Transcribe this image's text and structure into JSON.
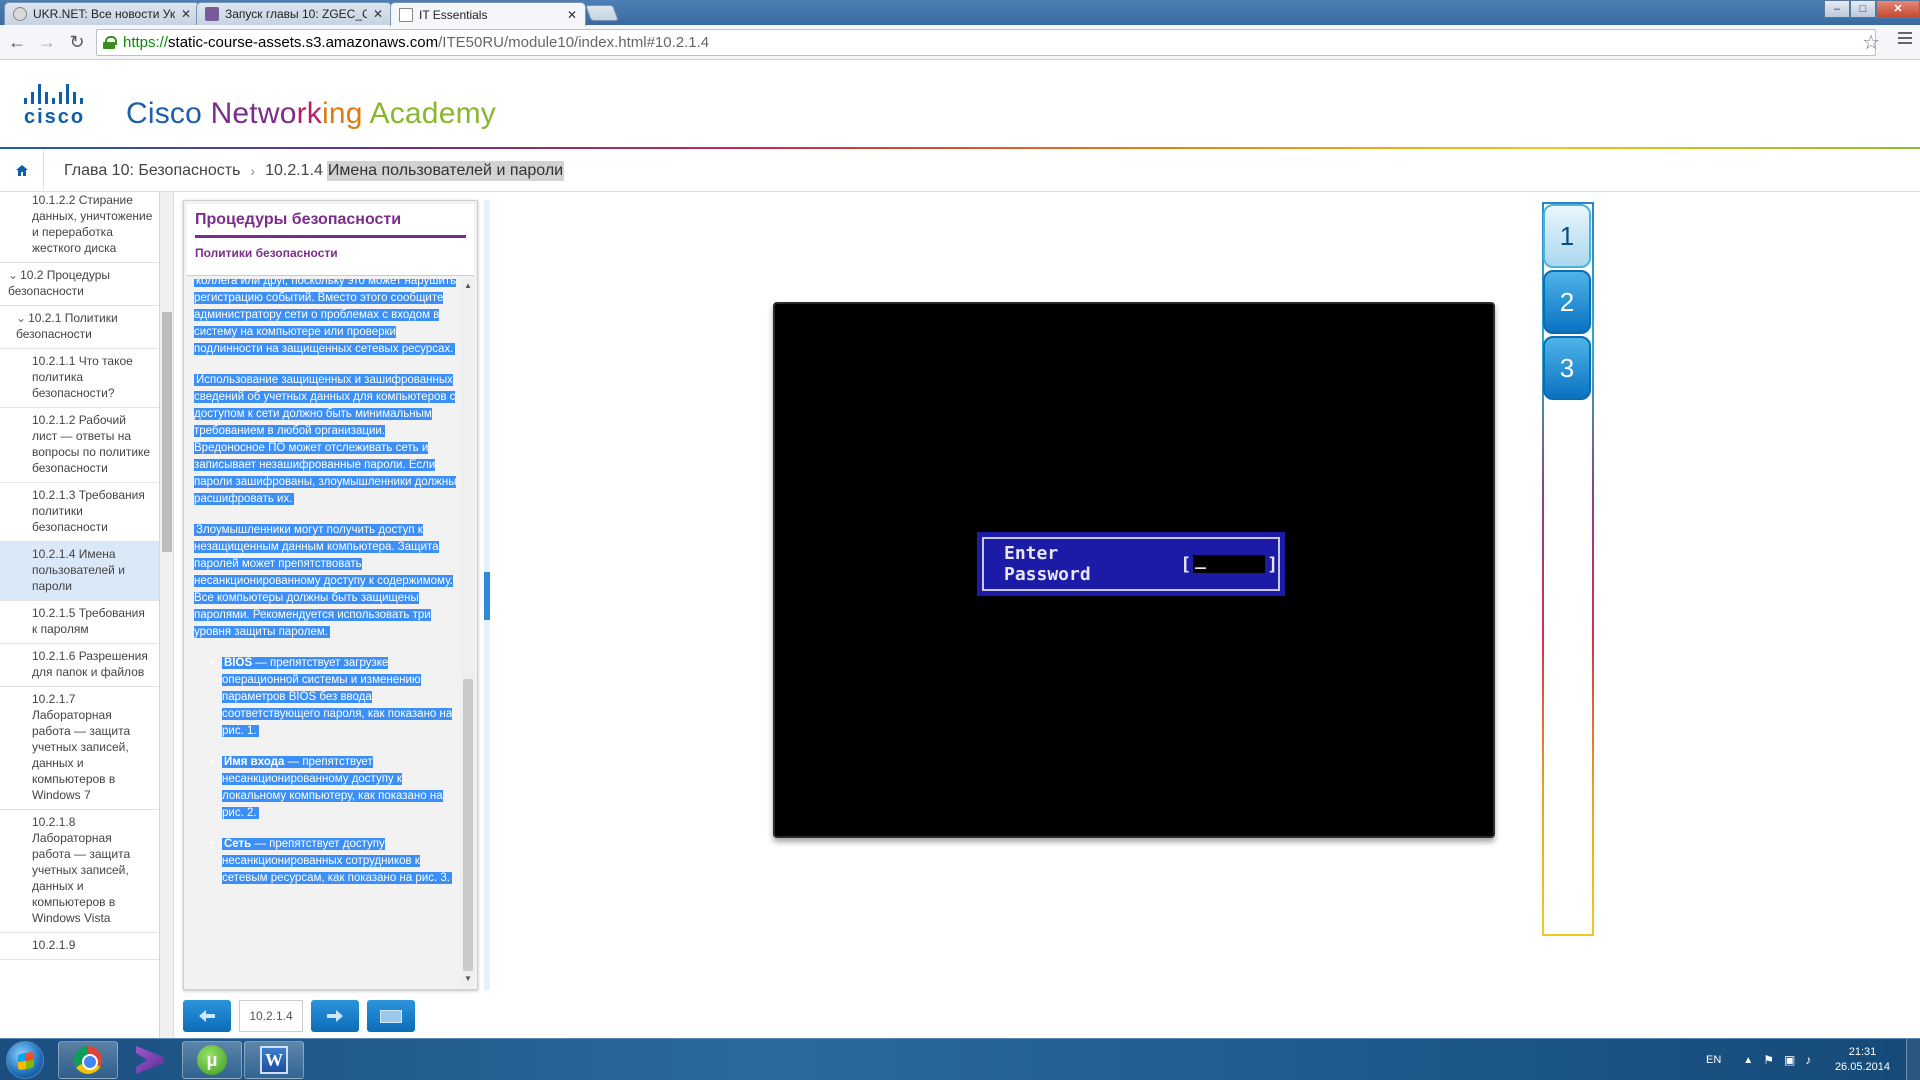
{
  "browser": {
    "tabs": [
      {
        "title": "UKR.NET: Все новости Ук",
        "favicon_color": "#d9d9d9"
      },
      {
        "title": "Запуск главы 10: ZGEC_G",
        "favicon_color": "#7a5a9a"
      },
      {
        "title": "IT Essentials",
        "favicon_color": "#ffffff"
      }
    ],
    "url": {
      "protocol": "https://",
      "host": "static-course-assets.s3.amazonaws.com",
      "path": "/ITE50RU/module10/index.html#10.2.1.4"
    },
    "window_controls": {
      "minimize": "–",
      "maximize": "□",
      "close": "✕"
    }
  },
  "header": {
    "logo_text": "cisco",
    "title_parts": [
      "Cisco ",
      "Netwo",
      "rk",
      "ing ",
      "Academy"
    ]
  },
  "breadcrumb": {
    "home_icon": "home-icon",
    "chapter": "Глава 10: Безопасность",
    "separator": "›",
    "section_num": "10.2.1.4",
    "section_title": "Имена пользователей и пароли"
  },
  "toc": {
    "items": [
      {
        "label": "10.1.2.2 Стирание данных, уничтожение и переработка жесткого диска",
        "level": 3,
        "active": false
      },
      {
        "label": "10.2 Процедуры безопасности",
        "level": 1,
        "caret": "⌄",
        "active": false
      },
      {
        "label": "10.2.1 Политики безопасности",
        "level": 2,
        "caret": "⌄",
        "active": false
      },
      {
        "label": "10.2.1.1 Что такое политика безопасности?",
        "level": 3,
        "active": false
      },
      {
        "label": "10.2.1.2 Рабочий лист — ответы на вопросы по политике безопасности",
        "level": 3,
        "active": false
      },
      {
        "label": "10.2.1.3 Требования политики безопасности",
        "level": 3,
        "active": false
      },
      {
        "label": "10.2.1.4 Имена пользователей и пароли",
        "level": 3,
        "active": true
      },
      {
        "label": "10.2.1.5 Требования к паролям",
        "level": 3,
        "active": false
      },
      {
        "label": "10.2.1.6 Разрешения для папок и файлов",
        "level": 3,
        "active": false
      },
      {
        "label": "10.2.1.7 Лабораторная работа — защита учетных записей, данных и компьютеров в Windows 7",
        "level": 3,
        "active": false
      },
      {
        "label": "10.2.1.8 Лабораторная работа — защита учетных записей, данных и компьютеров в Windows Vista",
        "level": 3,
        "active": false
      },
      {
        "label": "10.2.1.9",
        "level": 3,
        "active": false
      }
    ]
  },
  "panel": {
    "title": "Процедуры безопасности",
    "subtitle": "Политики безопасности",
    "paragraph_top": "коллега или друг, поскольку это может нарушить регистрацию событий. Вместо этого сообщите администратору сети о проблемах с входом в систему на компьютере или проверки подлинности на защищенных сетевых ресурсах.",
    "paragraph_2": "Использование защищенных и зашифрованных сведений об учетных данных для компьютеров с доступом к сети должно быть минимальным требованием в любой организации. Вредоносное ПО может отслеживать сеть и записывает незашифрованные пароли. Если пароли зашифрованы, злоумышленники должны расшифровать их.",
    "paragraph_3": "Злоумышленники могут получить доступ к незащищенным данным компьютера. Защита паролей может препятствовать несанкционированному доступу к содержимому. Все компьютеры должны быть защищены паролями. Рекомендуется использовать три уровня защиты паролем.",
    "bullets": [
      {
        "term": "BIOS",
        "text": " — препятствует загрузке операционной системы и изменению параметров BIOS без ввода соответствующего пароля, как показано на рис. 1."
      },
      {
        "term": "Имя входа",
        "text": " — препятствует несанкционированному доступу к локальному компьютеру, как показано на рис. 2."
      },
      {
        "term": "Сеть",
        "text": " — препятствует доступу несанкционированных сотрудников к сетевым ресурсам, как показано на рис. 3."
      }
    ]
  },
  "bottom_nav": {
    "prev_icon": "arrow-left-icon",
    "page": "10.2.1.4",
    "next_icon": "arrow-right-icon",
    "keyboard_icon": "keyboard-icon"
  },
  "media": {
    "prompt_label": "Enter Password",
    "field_left": "[",
    "field_right": "]"
  },
  "figures": {
    "buttons": [
      "1",
      "2",
      "3"
    ],
    "active": "1"
  },
  "taskbar": {
    "language": "EN",
    "time": "21:31",
    "date": "26.05.2014"
  }
}
